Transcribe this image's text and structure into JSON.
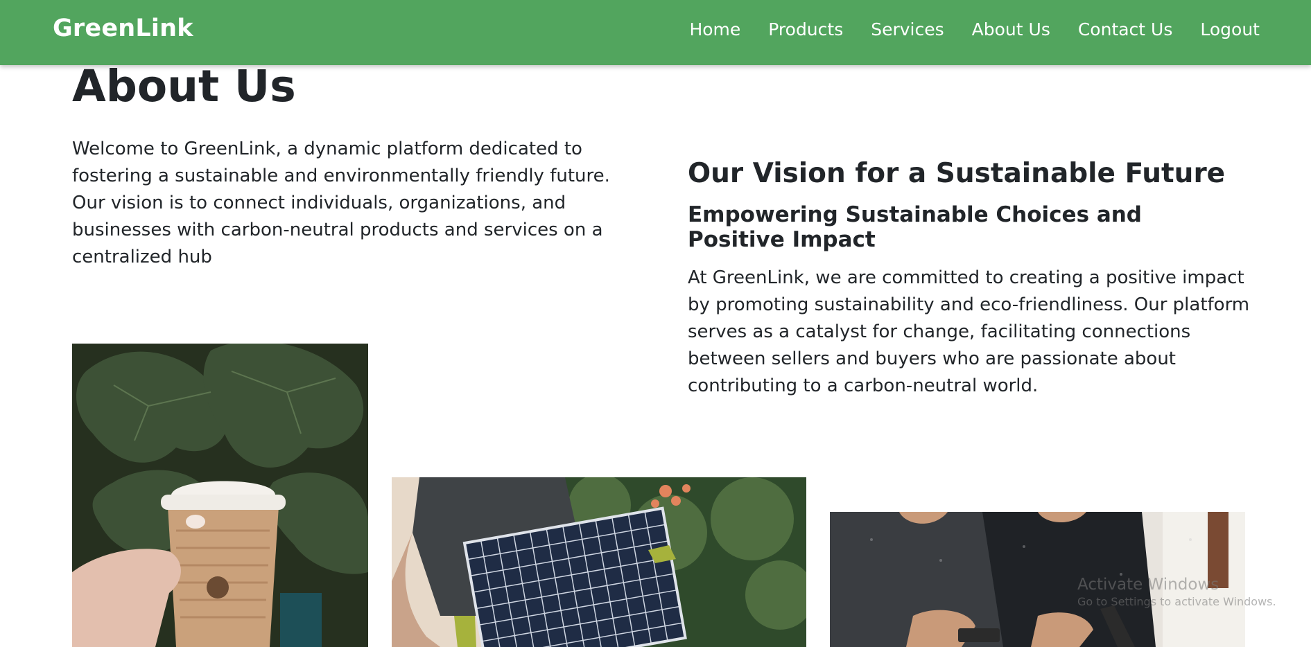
{
  "colors": {
    "brand": "#52a55e",
    "text": "#212529",
    "nav_text": "#ffffff"
  },
  "navbar": {
    "brand": "GreenLink",
    "links": [
      "Home",
      "Products",
      "Services",
      "About Us",
      "Contact Us",
      "Logout"
    ]
  },
  "main": {
    "title": "About Us",
    "intro": "Welcome to GreenLink, a dynamic platform dedicated to fostering a sustainable and environmentally friendly future. Our vision is to connect individuals, organizations, and businesses with carbon-neutral products and services on a centralized hub"
  },
  "vision": {
    "title": "Our Vision for a Sustainable Future",
    "subtitle": "Empowering Sustainable Choices and Positive Impact",
    "body": "At GreenLink, we are committed to creating a positive impact by promoting sustainability and eco-friendliness. Our platform serves as a catalyst for change, facilitating connections between sellers and buyers who are passionate about contributing to a carbon-neutral world."
  },
  "gallery": {
    "items": [
      {
        "name": "coffee-cup-photo"
      },
      {
        "name": "solar-panel-photo"
      },
      {
        "name": "team-photo"
      }
    ]
  },
  "watermark": {
    "title": "Activate Windows",
    "subtitle": "Go to Settings to activate Windows."
  }
}
